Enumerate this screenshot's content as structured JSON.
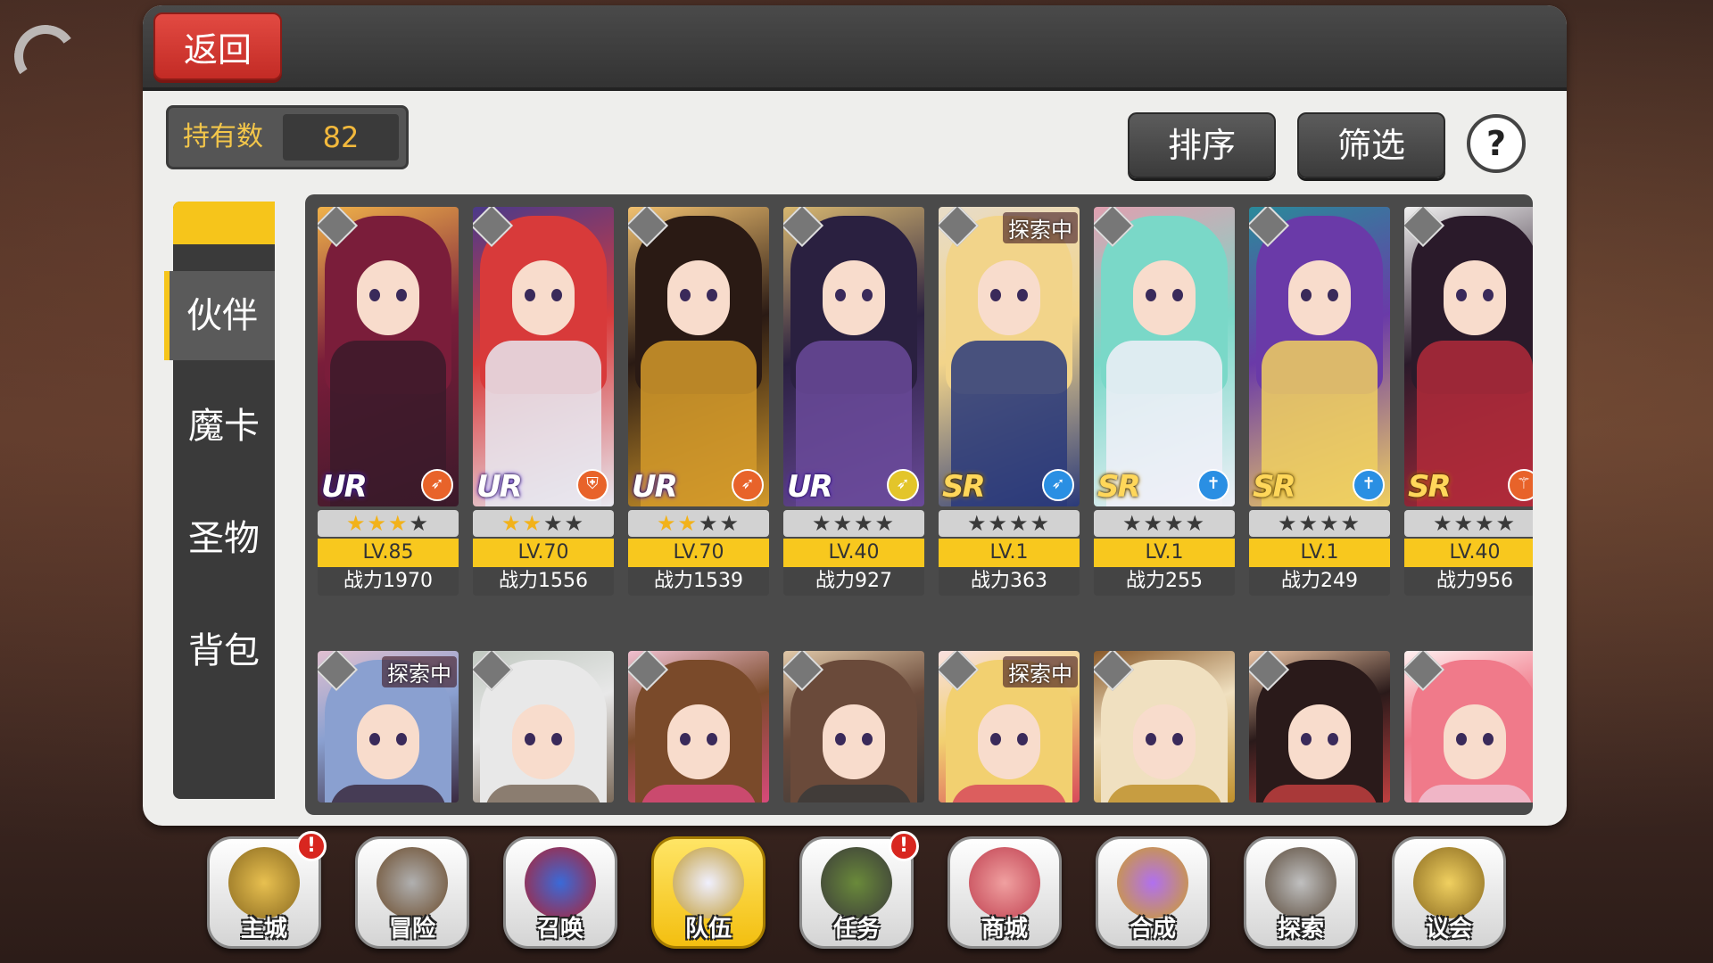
{
  "header": {
    "back_label": "返回"
  },
  "owned": {
    "label": "持有数",
    "value": "82"
  },
  "toolbar": {
    "sort_label": "排序",
    "filter_label": "筛选",
    "help_label": "?"
  },
  "side_tabs": [
    {
      "label": "伙伴",
      "active": true
    },
    {
      "label": "魔卡",
      "active": false
    },
    {
      "label": "圣物",
      "active": false
    },
    {
      "label": "背包",
      "active": false
    }
  ],
  "cards_row1": [
    {
      "rarity": "UR",
      "stars_on": 3,
      "level": "LV.85",
      "power": "战力1970",
      "exploring": "",
      "role_icon": "bow-icon",
      "role_color": "#e8632a"
    },
    {
      "rarity": "UR",
      "stars_on": 2,
      "level": "LV.70",
      "power": "战力1556",
      "exploring": "",
      "role_icon": "shield-icon",
      "role_color": "#e8632a"
    },
    {
      "rarity": "UR",
      "stars_on": 2,
      "level": "LV.70",
      "power": "战力1539",
      "exploring": "",
      "role_icon": "bow-icon",
      "role_color": "#e8632a"
    },
    {
      "rarity": "UR",
      "stars_on": 0,
      "level": "LV.40",
      "power": "战力927",
      "exploring": "",
      "role_icon": "bow-icon",
      "role_color": "#e3c52a"
    },
    {
      "rarity": "SR",
      "stars_on": 0,
      "level": "LV.1",
      "power": "战力363",
      "exploring": "探索中",
      "role_icon": "bow-icon",
      "role_color": "#2a8fe3"
    },
    {
      "rarity": "SR",
      "stars_on": 0,
      "level": "LV.1",
      "power": "战力255",
      "exploring": "",
      "role_icon": "cross-icon",
      "role_color": "#2a8fe3"
    },
    {
      "rarity": "SR",
      "stars_on": 0,
      "level": "LV.1",
      "power": "战力249",
      "exploring": "",
      "role_icon": "cross-icon",
      "role_color": "#2a8fe3"
    },
    {
      "rarity": "SR",
      "stars_on": 0,
      "level": "LV.40",
      "power": "战力956",
      "exploring": "",
      "role_icon": "staff-icon",
      "role_color": "#e8632a"
    }
  ],
  "cards_row2": [
    {
      "exploring": "探索中"
    },
    {
      "exploring": ""
    },
    {
      "exploring": ""
    },
    {
      "exploring": ""
    },
    {
      "exploring": "探索中"
    },
    {
      "exploring": ""
    },
    {
      "exploring": ""
    },
    {
      "exploring": ""
    }
  ],
  "bottom_nav": [
    {
      "label": "主城",
      "icon": "castle-icon",
      "alert": "!"
    },
    {
      "label": "冒险",
      "icon": "swords-icon",
      "alert": ""
    },
    {
      "label": "召唤",
      "icon": "summon-card-icon",
      "alert": ""
    },
    {
      "label": "队伍",
      "icon": "team-emblem-icon",
      "alert": "",
      "active": true
    },
    {
      "label": "任务",
      "icon": "quest-book-icon",
      "alert": "!"
    },
    {
      "label": "商城",
      "icon": "shop-tree-icon",
      "alert": ""
    },
    {
      "label": "合成",
      "icon": "potion-icon",
      "alert": ""
    },
    {
      "label": "探索",
      "icon": "shovel-icon",
      "alert": ""
    },
    {
      "label": "议会",
      "icon": "council-crest-icon",
      "alert": ""
    }
  ],
  "colors": {
    "accent_yellow": "#f6c51b",
    "back_red": "#d23a33",
    "panel": "#eeeeec"
  }
}
